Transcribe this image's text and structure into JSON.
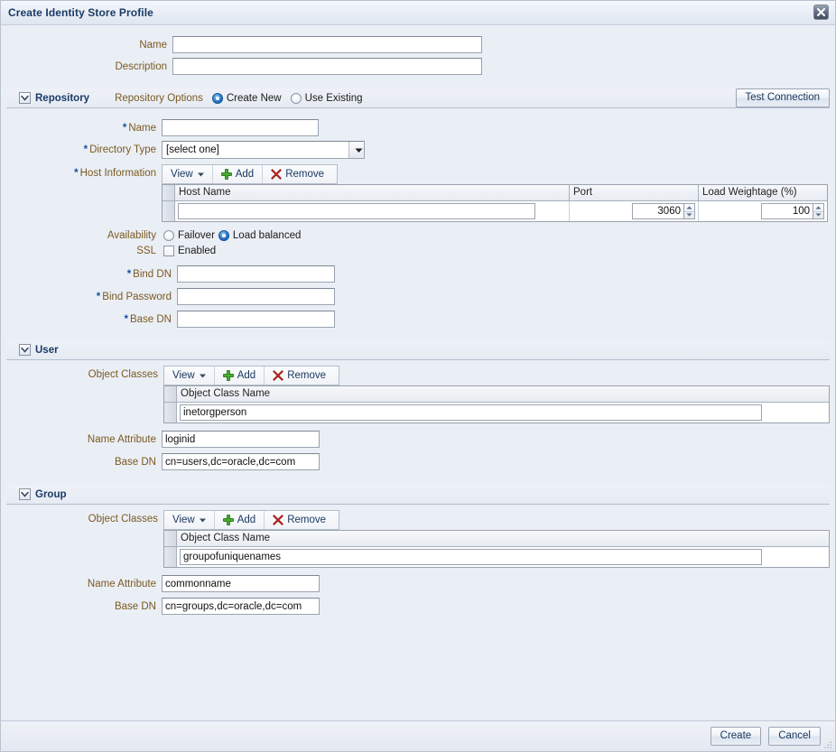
{
  "window": {
    "title": "Create Identity Store Profile",
    "close_icon": "close-icon"
  },
  "top": {
    "name_label": "Name",
    "name_value": "",
    "description_label": "Description",
    "description_value": ""
  },
  "repository": {
    "section_title": "Repository",
    "options_label": "Repository Options",
    "option_create_new": "Create New",
    "option_use_existing": "Use Existing",
    "selected_option": "Create New",
    "test_connection_label": "Test Connection",
    "name_label": "Name",
    "name_value": "",
    "directory_type_label": "Directory Type",
    "directory_type_value": "[select one]",
    "host_information_label": "Host Information",
    "toolbar": {
      "view_label": "View",
      "add_label": "Add",
      "remove_label": "Remove"
    },
    "table": {
      "columns": [
        "Host Name",
        "Port",
        "Load Weightage (%)"
      ],
      "rows": [
        {
          "host_name": "",
          "port": "3060",
          "load_weightage": "100"
        }
      ]
    },
    "availability_label": "Availability",
    "availability_failover": "Failover",
    "availability_load_balanced": "Load balanced",
    "availability_selected": "Load balanced",
    "ssl_label": "SSL",
    "ssl_enabled_label": "Enabled",
    "ssl_checked": false,
    "bind_dn_label": "Bind DN",
    "bind_dn_value": "",
    "bind_password_label": "Bind Password",
    "bind_password_value": "",
    "base_dn_label": "Base DN",
    "base_dn_value": ""
  },
  "user": {
    "section_title": "User",
    "object_classes_label": "Object Classes",
    "toolbar": {
      "view_label": "View",
      "add_label": "Add",
      "remove_label": "Remove"
    },
    "table": {
      "columns": [
        "Object Class Name"
      ],
      "rows": [
        {
          "object_class_name": "inetorgperson"
        }
      ]
    },
    "name_attribute_label": "Name Attribute",
    "name_attribute_value": "loginid",
    "base_dn_label": "Base DN",
    "base_dn_value": "cn=users,dc=oracle,dc=com"
  },
  "group": {
    "section_title": "Group",
    "object_classes_label": "Object Classes",
    "toolbar": {
      "view_label": "View",
      "add_label": "Add",
      "remove_label": "Remove"
    },
    "table": {
      "columns": [
        "Object Class Name"
      ],
      "rows": [
        {
          "object_class_name": "groupofuniquenames"
        }
      ]
    },
    "name_attribute_label": "Name Attribute",
    "name_attribute_value": "commonname",
    "base_dn_label": "Base DN",
    "base_dn_value": "cn=groups,dc=oracle,dc=com"
  },
  "footer": {
    "create_label": "Create",
    "cancel_label": "Cancel"
  },
  "colors": {
    "dialog_background": "#eaeef5",
    "title_text": "#1b3b66",
    "field_label": "#7a5a22",
    "required_marker": "#14519e",
    "radio_selected": "#14549b",
    "add_icon": "#3f9e26",
    "remove_icon": "#cc2a1f"
  }
}
